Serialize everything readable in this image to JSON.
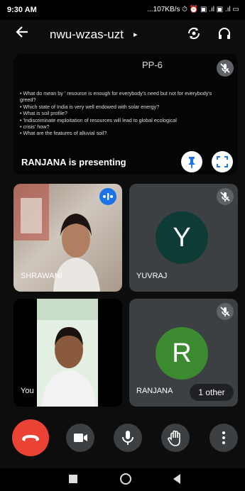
{
  "status_bar": {
    "time": "9:30 AM",
    "indicators": "...107KB/s ⏱ ⏰ ▣ .ıl ▣ .ıl ▭"
  },
  "app_bar": {
    "meeting_code": "nwu-wzas-uzt",
    "caret": "▸"
  },
  "presentation": {
    "slide_title": "PP-6",
    "lines": [
      "What do mean by ' resource is enough for everybody's need but not for everybody's greed?",
      "Which state of India is very well endowed with solar energy?",
      "What is soil profile?",
      "'Indiscriminate exploitation of resources will lead to global ecological",
      "crisis' how?",
      "What are the features of alluvial soil?"
    ],
    "presenter_label": "RANJANA is presenting"
  },
  "participants": {
    "shrawani": {
      "name": "SHRAWANI"
    },
    "yuvraj": {
      "name": "YUVRAJ",
      "initial": "Y",
      "avatar_color": "#0d3b35"
    },
    "you": {
      "name": "You"
    },
    "ranjana": {
      "name": "RANJANA",
      "initial": "R",
      "avatar_color": "#3d8b31",
      "others": "1 other"
    }
  },
  "controls": {
    "end_call_color": "#ea4335"
  }
}
